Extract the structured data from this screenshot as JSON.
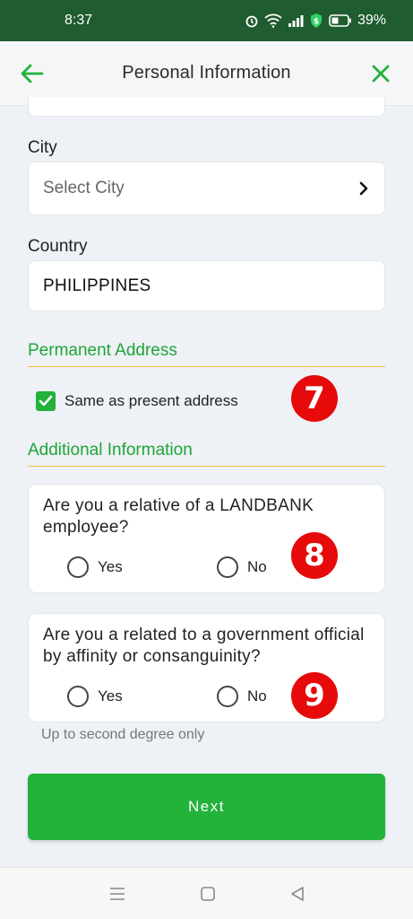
{
  "status_bar": {
    "time": "8:37",
    "battery": "39%"
  },
  "app_bar": {
    "title": "Personal Information",
    "back_icon": "arrow-left-icon",
    "close_icon": "close-icon",
    "accent_color": "#23b23a"
  },
  "fields": {
    "city": {
      "label": "City",
      "placeholder": "Select City"
    },
    "country": {
      "label": "Country",
      "value": "PHILIPPINES"
    }
  },
  "permanent_address": {
    "title": "Permanent Address",
    "checkbox_label": "Same as present address",
    "checked": true
  },
  "additional_information": {
    "title": "Additional Information",
    "questions": [
      {
        "text": "Are you a relative of a LANDBANK employee?",
        "options": [
          "Yes",
          "No"
        ]
      },
      {
        "text": "Are you a related to a government official by affinity or consanguinity?",
        "options": [
          "Yes",
          "No"
        ],
        "hint": "Up to second degree only"
      }
    ]
  },
  "badges": [
    "7",
    "8",
    "9"
  ],
  "next_button": {
    "label": "Next"
  }
}
